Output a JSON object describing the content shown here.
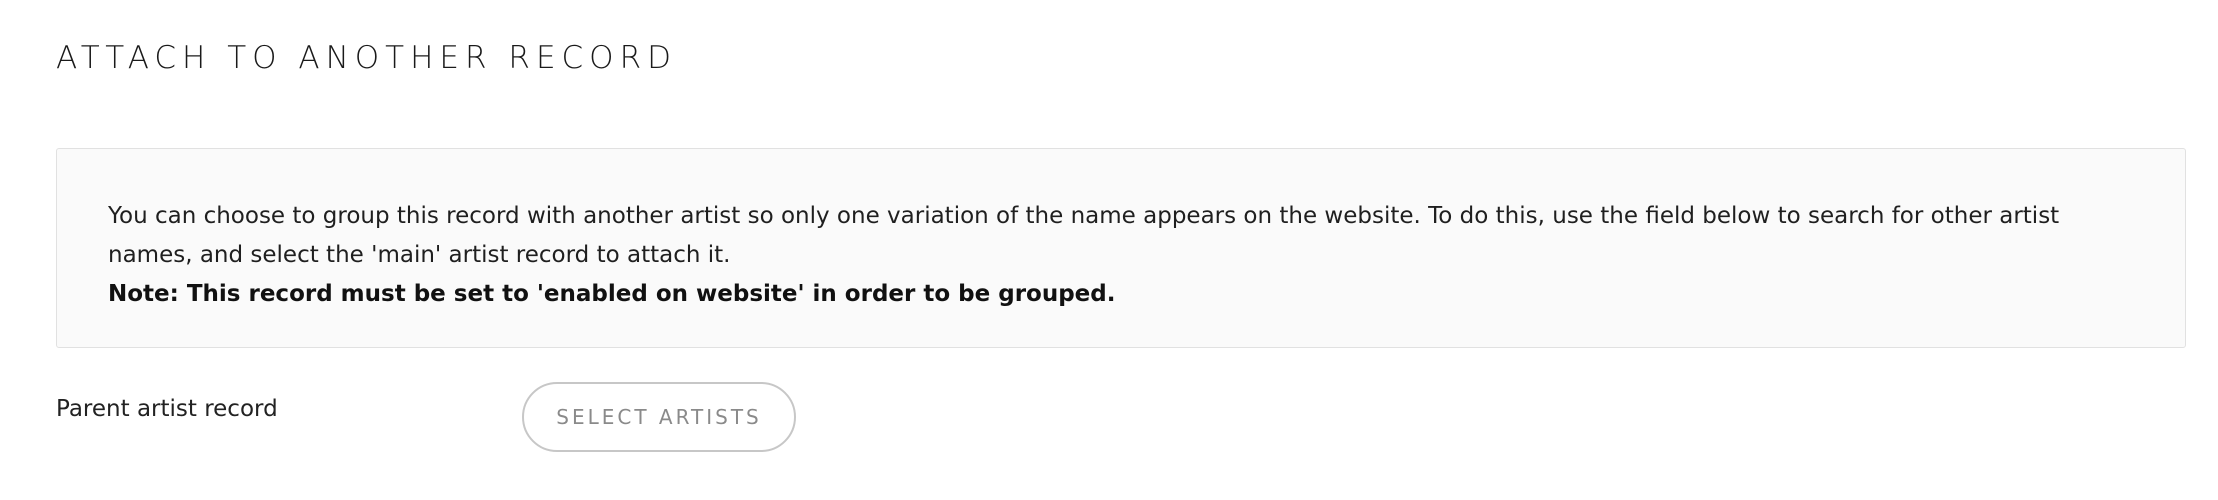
{
  "section": {
    "title": "ATTACH TO ANOTHER RECORD"
  },
  "info": {
    "text": "You can choose to group this record with another artist so only one variation of the name appears on the website. To do this, use the field below to search for other artist names, and select the 'main' artist record to attach it.",
    "note": "Note: This record must be set to 'enabled on website' in order to be grouped."
  },
  "parent_field": {
    "label": "Parent artist record",
    "button_label": "SELECT ARTISTS"
  },
  "colors": {
    "box_background": "#fafafa",
    "box_border": "#e1e1e1",
    "button_border": "#c7c7c7",
    "button_text": "#8a8a8a"
  }
}
